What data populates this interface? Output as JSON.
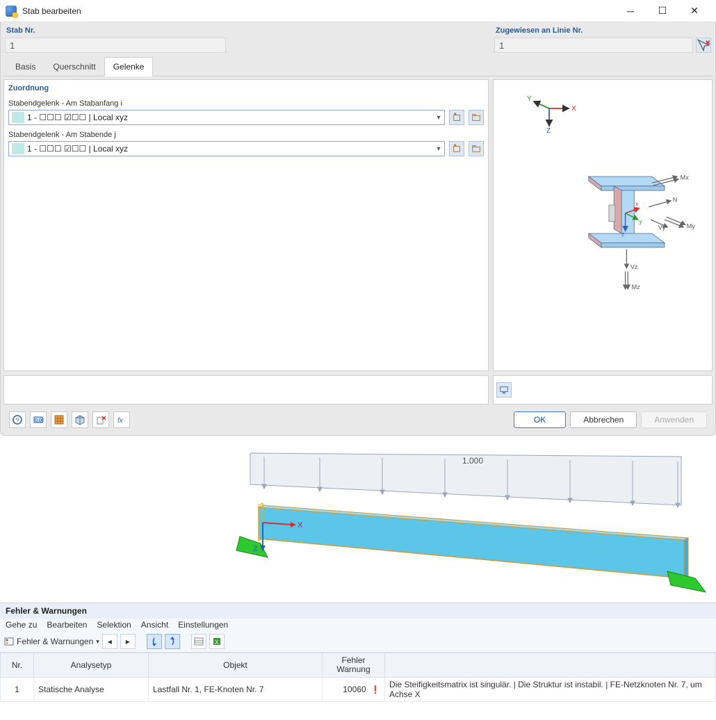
{
  "window": {
    "title": "Stab bearbeiten"
  },
  "top": {
    "stab_nr_label": "Stab Nr.",
    "stab_nr_value": "1",
    "zugewiesen_label": "Zugewiesen an Linie Nr.",
    "zugewiesen_value": "1"
  },
  "tabs": {
    "basis": "Basis",
    "querschnitt": "Querschnitt",
    "gelenke": "Gelenke"
  },
  "gelenke": {
    "section_title": "Zuordnung",
    "start_label": "Stabendgelenk - Am Stabanfang i",
    "start_value": "1 - ☐☐☐ ☑☐☐ | Local xyz",
    "end_label": "Stabendgelenk - Am Stabende j",
    "end_value": "1 - ☐☐☐ ☑☐☐ | Local xyz"
  },
  "preview_axes": {
    "x": "X",
    "y": "Y",
    "z": "Z",
    "small_x": "x",
    "small_y": "y",
    "small_z": "z",
    "N": "N",
    "Vy": "Vy",
    "My": "My",
    "Mx": "Mx",
    "Vz": "Vz",
    "Mz": "Mz"
  },
  "footer": {
    "ok": "OK",
    "cancel": "Abbrechen",
    "apply": "Anwenden"
  },
  "viewport": {
    "load_value": "1.000",
    "axis_x": "X",
    "axis_z": "Z"
  },
  "errors": {
    "title": "Fehler & Warnungen",
    "menu": {
      "geh": "Gehe zu",
      "bearb": "Bearbeiten",
      "sel": "Selektion",
      "ans": "Ansicht",
      "einst": "Einstellungen"
    },
    "crumb": "Fehler & Warnungen",
    "columns": {
      "nr": "Nr.",
      "analysetyp": "Analysetyp",
      "objekt": "Objekt",
      "fehler_line1": "Fehler",
      "fehler_line2": "Warnung",
      "desc": ""
    },
    "row": {
      "nr": "1",
      "analysetyp": "Statische Analyse",
      "objekt": "Lastfall Nr. 1, FE-Knoten Nr. 7",
      "code": "10060",
      "desc": "Die Steifigkeitsmatrix ist singulär. |  Die Struktur ist instabil. | FE-Netzknoten Nr. 7, um Achse X"
    }
  }
}
